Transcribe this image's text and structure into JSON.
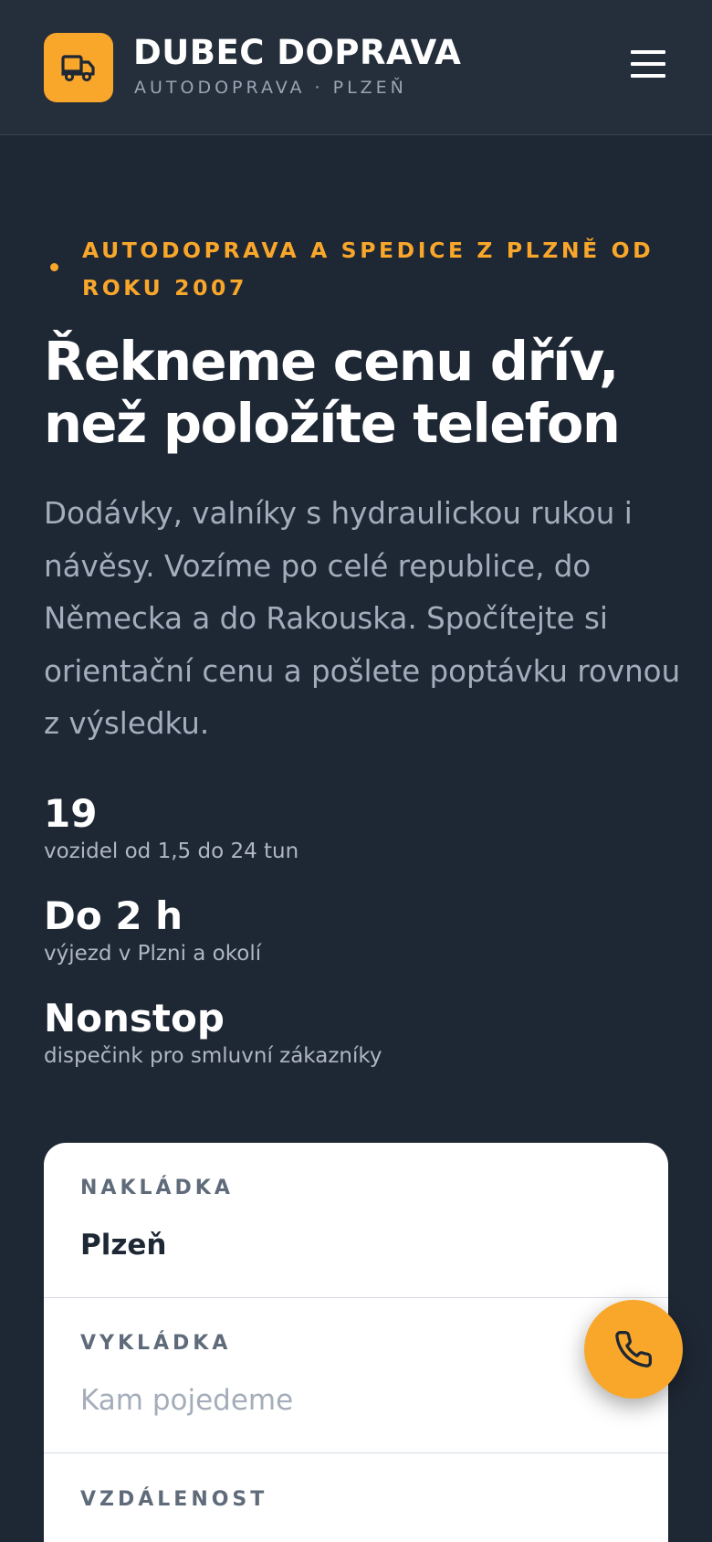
{
  "header": {
    "brand_name": "DUBEC DOPRAVA",
    "brand_sub": "AUTODOPRAVA · PLZEŇ",
    "logo_icon": "truck-icon",
    "menu_icon": "hamburger-menu-icon"
  },
  "hero": {
    "eyebrow": "AUTODOPRAVA A SPEDICE Z PLZNĚ OD ROKU 2007",
    "title_line1": "Řekneme cenu dřív,",
    "title_line2": "než položíte telefon",
    "text": "Dodávky, valníky s hydraulickou rukou i návěsy. Vozíme po celé republice, do Německa a do Rakouska. Spočítejte si orientační cenu a pošlete poptávku rovnou z výsledku."
  },
  "stats": [
    {
      "value": "19",
      "label": "vozidel od 1,5 do 24 tun"
    },
    {
      "value": "Do 2 h",
      "label": "výjezd v Plzni a okolí"
    },
    {
      "value": "Nonstop",
      "label": "dispečink pro smluvní zákazníky"
    }
  ],
  "calculator": {
    "loading": {
      "label": "NAKLÁDKA",
      "value": "Plzeň",
      "placeholder": ""
    },
    "unloading": {
      "label": "VYKLÁDKA",
      "value": "",
      "placeholder": "Kam pojedeme"
    },
    "distance": {
      "label": "VZDÁLENOST"
    }
  },
  "call_button": {
    "icon": "phone-icon"
  },
  "colors": {
    "accent": "#f9a72b",
    "background": "#1e2734",
    "header": "#252e3b",
    "muted_text": "#a3adbb",
    "card": "#ffffff"
  }
}
